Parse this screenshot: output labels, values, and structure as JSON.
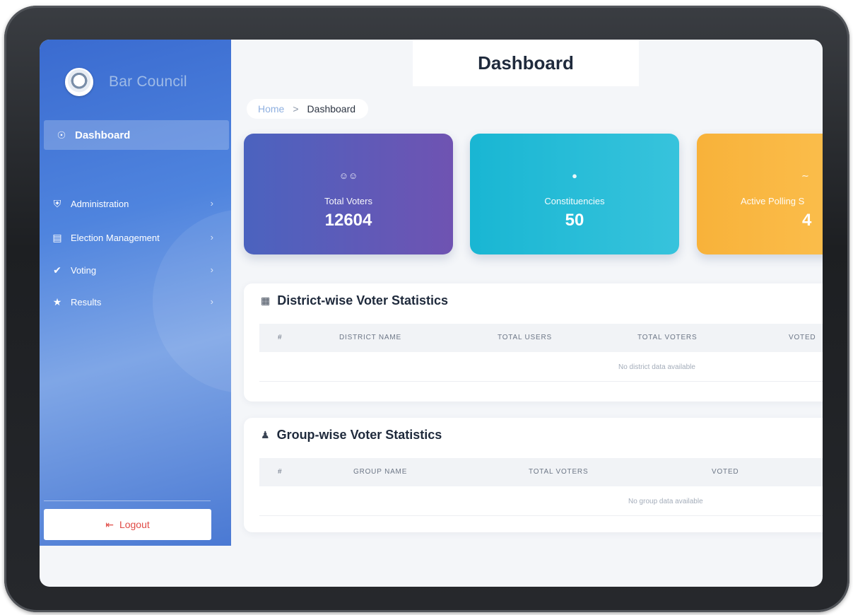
{
  "sidebar": {
    "brand": "Bar Council",
    "active_item": {
      "label": "Dashboard",
      "icon": "dashboard-icon"
    },
    "items": [
      {
        "label": "Administration",
        "icon": "building-icon"
      },
      {
        "label": "Election Management",
        "icon": "inbox-icon"
      },
      {
        "label": "Voting",
        "icon": "check-shield-icon"
      },
      {
        "label": "Results",
        "icon": "trophy-icon"
      }
    ],
    "logout": "Logout"
  },
  "header": {
    "title": "Dashboard"
  },
  "breadcrumb": {
    "home": "Home",
    "separator": ">",
    "current": "Dashboard"
  },
  "stats": [
    {
      "label": "Total Voters",
      "value": "12604",
      "icon": "users-icon",
      "color": "#5a5cbb"
    },
    {
      "label": "Constituencies",
      "value": "50",
      "icon": "globe-icon",
      "color": "#22bbd6"
    },
    {
      "label": "Active Polling S",
      "value": "4",
      "icon": "signal-icon",
      "color": "#f9b640"
    }
  ],
  "district_table": {
    "title": "District-wise Voter Statistics",
    "icon": "map-icon",
    "columns": [
      "#",
      "District Name",
      "Total Users",
      "Total Voters",
      "Voted"
    ],
    "empty_message": "No district data available"
  },
  "group_table": {
    "title": "Group-wise Voter Statistics",
    "icon": "group-icon",
    "columns": [
      "#",
      "Group Name",
      "Total Voters",
      "Voted"
    ],
    "empty_message": "No group data available"
  }
}
